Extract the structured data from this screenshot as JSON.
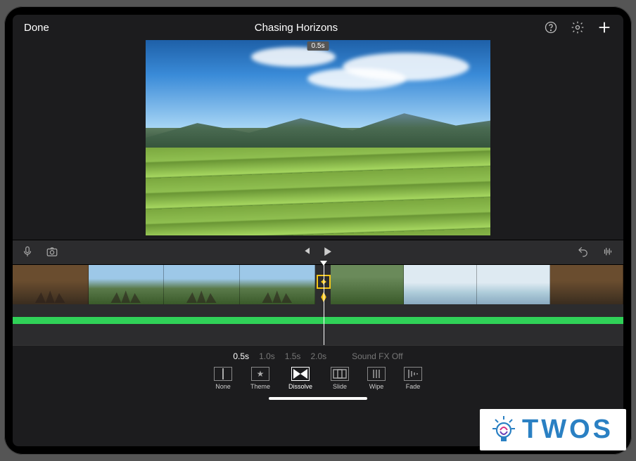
{
  "header": {
    "done_label": "Done",
    "title": "Chasing Horizons"
  },
  "preview": {
    "time_badge": "0.5s"
  },
  "durations": {
    "options": [
      "0.5s",
      "1.0s",
      "1.5s",
      "2.0s"
    ],
    "selected": "0.5s",
    "sound_fx_label": "Sound FX Off"
  },
  "transitions": {
    "items": [
      {
        "key": "none",
        "label": "None"
      },
      {
        "key": "theme",
        "label": "Theme"
      },
      {
        "key": "dissolve",
        "label": "Dissolve"
      },
      {
        "key": "slide",
        "label": "Slide"
      },
      {
        "key": "wipe",
        "label": "Wipe"
      },
      {
        "key": "fade",
        "label": "Fade"
      }
    ],
    "selected": "dissolve"
  },
  "logo": {
    "text": "TWOS"
  },
  "icons": {
    "help": "help-icon",
    "settings": "gear-icon",
    "add": "plus-icon",
    "mic": "microphone-icon",
    "camera": "camera-icon",
    "skip_back": "skip-back-icon",
    "play": "play-icon",
    "undo": "undo-icon",
    "waveform": "waveform-icon"
  }
}
